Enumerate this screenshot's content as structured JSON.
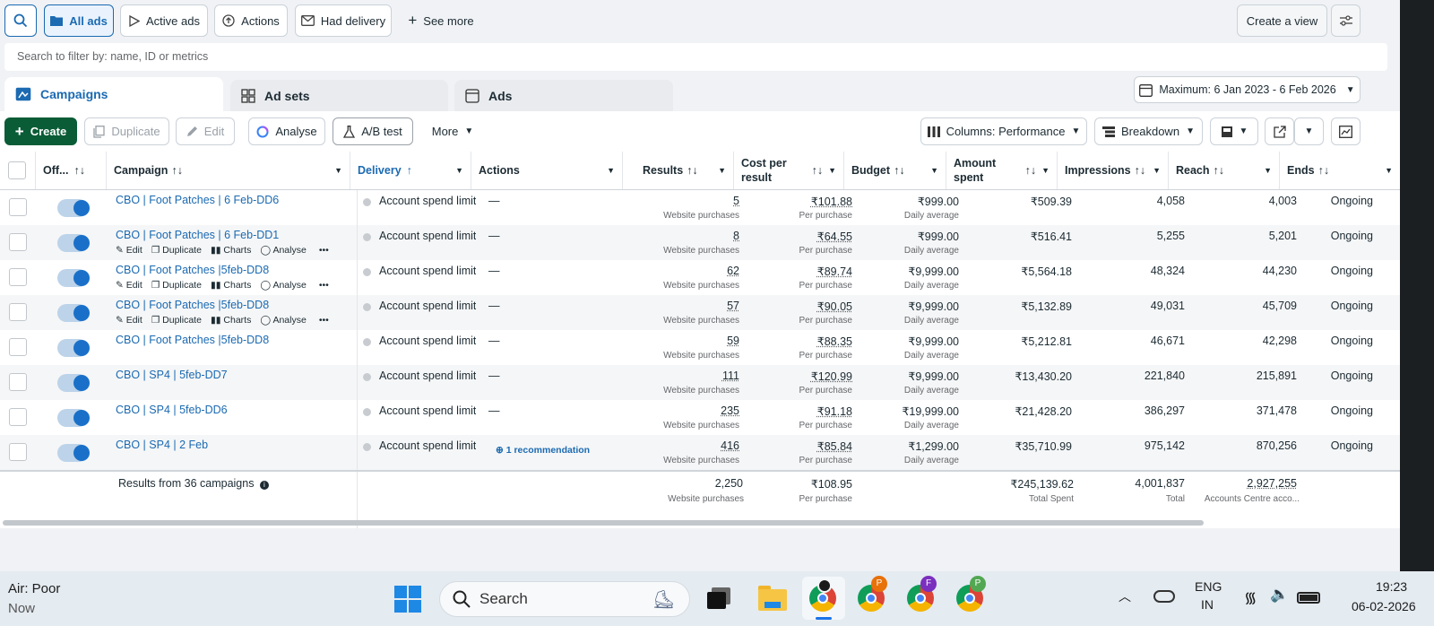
{
  "filters": {
    "all_ads": "All ads",
    "active_ads": "Active ads",
    "actions": "Actions",
    "had_delivery": "Had delivery",
    "see_more": "See more",
    "create_view": "Create a view"
  },
  "search": {
    "placeholder": "Search to filter by: name, ID or metrics"
  },
  "tabs": {
    "campaigns": "Campaigns",
    "ad_sets": "Ad sets",
    "ads": "Ads"
  },
  "date_range": "Maximum: 6 Jan 2023 - 6 Feb 2026",
  "toolbar": {
    "create": "Create",
    "duplicate": "Duplicate",
    "edit": "Edit",
    "analyse": "Analyse",
    "ab_test": "A/B test",
    "more": "More",
    "columns": "Columns: Performance",
    "breakdown": "Breakdown"
  },
  "headers": {
    "off": "Off...",
    "campaign": "Campaign",
    "delivery": "Delivery",
    "actions": "Actions",
    "results": "Results",
    "cost_per_result_1": "Cost per",
    "cost_per_result_2": "result",
    "budget": "Budget",
    "amount_spent_1": "Amount",
    "amount_spent_2": "spent",
    "impressions": "Impressions",
    "reach": "Reach",
    "ends": "Ends"
  },
  "row_actions": {
    "edit": "Edit",
    "duplicate": "Duplicate",
    "charts": "Charts",
    "analyse": "Analyse"
  },
  "rows": [
    {
      "name": "CBO | Foot Patches | 6 Feb-DD6",
      "delivery": "Account spend limit",
      "actions": "—",
      "results": "5",
      "results_sub": "Website purchases",
      "cost": "₹101.88",
      "cost_sub": "Per purchase",
      "budget": "₹999.00",
      "budget_sub": "Daily average",
      "spent": "₹509.39",
      "impressions": "4,058",
      "reach": "4,003",
      "ends": "Ongoing"
    },
    {
      "name": "CBO | Foot Patches | 6 Feb-DD1",
      "delivery": "Account spend limit",
      "actions": "—",
      "results": "8",
      "results_sub": "Website purchases",
      "cost": "₹64.55",
      "cost_sub": "Per purchase",
      "budget": "₹999.00",
      "budget_sub": "Daily average",
      "spent": "₹516.41",
      "impressions": "5,255",
      "reach": "5,201",
      "ends": "Ongoing"
    },
    {
      "name": "CBO | Foot Patches |5feb-DD8",
      "delivery": "Account spend limit",
      "actions": "—",
      "results": "62",
      "results_sub": "Website purchases",
      "cost": "₹89.74",
      "cost_sub": "Per purchase",
      "budget": "₹9,999.00",
      "budget_sub": "Daily average",
      "spent": "₹5,564.18",
      "impressions": "48,324",
      "reach": "44,230",
      "ends": "Ongoing"
    },
    {
      "name": "CBO | Foot Patches |5feb-DD8",
      "delivery": "Account spend limit",
      "actions": "—",
      "results": "57",
      "results_sub": "Website purchases",
      "cost": "₹90.05",
      "cost_sub": "Per purchase",
      "budget": "₹9,999.00",
      "budget_sub": "Daily average",
      "spent": "₹5,132.89",
      "impressions": "49,031",
      "reach": "45,709",
      "ends": "Ongoing"
    },
    {
      "name": "CBO | Foot Patches |5feb-DD8",
      "delivery": "Account spend limit",
      "actions": "—",
      "results": "59",
      "results_sub": "Website purchases",
      "cost": "₹88.35",
      "cost_sub": "Per purchase",
      "budget": "₹9,999.00",
      "budget_sub": "Daily average",
      "spent": "₹5,212.81",
      "impressions": "46,671",
      "reach": "42,298",
      "ends": "Ongoing"
    },
    {
      "name": "CBO | SP4 | 5feb-DD7",
      "delivery": "Account spend limit",
      "actions": "—",
      "results": "111",
      "results_sub": "Website purchases",
      "cost": "₹120.99",
      "cost_sub": "Per purchase",
      "budget": "₹9,999.00",
      "budget_sub": "Daily average",
      "spent": "₹13,430.20",
      "impressions": "221,840",
      "reach": "215,891",
      "ends": "Ongoing"
    },
    {
      "name": "CBO | SP4 | 5feb-DD6",
      "delivery": "Account spend limit",
      "actions": "—",
      "results": "235",
      "results_sub": "Website purchases",
      "cost": "₹91.18",
      "cost_sub": "Per purchase",
      "budget": "₹19,999.00",
      "budget_sub": "Daily average",
      "spent": "₹21,428.20",
      "impressions": "386,297",
      "reach": "371,478",
      "ends": "Ongoing"
    },
    {
      "name": "CBO | SP4 | 2 Feb",
      "delivery": "Account spend limit",
      "actions": "1 recommendation",
      "results": "416",
      "results_sub": "Website purchases",
      "cost": "₹85.84",
      "cost_sub": "Per purchase",
      "budget": "₹1,299.00",
      "budget_sub": "Daily average",
      "spent": "₹35,710.99",
      "impressions": "975,142",
      "reach": "870,256",
      "ends": "Ongoing"
    }
  ],
  "totals": {
    "label": "Results from 36 campaigns",
    "results": "2,250",
    "results_sub": "Website purchases",
    "cost": "₹108.95",
    "cost_sub": "Per purchase",
    "spent": "₹245,139.62",
    "spent_sub": "Total Spent",
    "impressions": "4,001,837",
    "impressions_sub": "Total",
    "reach": "2,927,255",
    "reach_sub": "Accounts Centre acco..."
  },
  "taskbar": {
    "weather_title": "Air: Poor",
    "weather_sub": "Now",
    "search": "Search",
    "lang_1": "ENG",
    "lang_2": "IN",
    "time": "19:23",
    "date": "06-02-2026",
    "profile_badges": [
      "P",
      "F",
      "P"
    ]
  },
  "colors": {
    "primary_green": "#0a5c36",
    "link_blue": "#1b6ab2",
    "toggle_blue": "#1a70c8"
  }
}
